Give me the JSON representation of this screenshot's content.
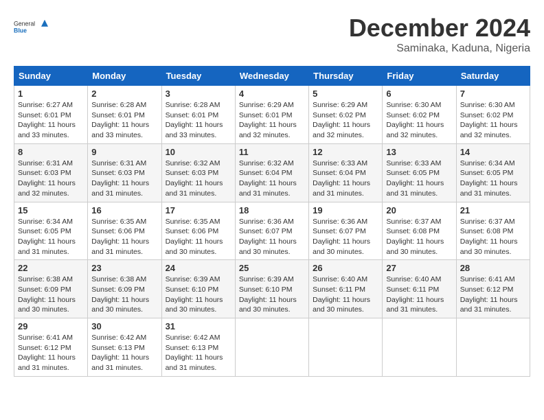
{
  "header": {
    "logo_general": "General",
    "logo_blue": "Blue",
    "month_year": "December 2024",
    "location": "Saminaka, Kaduna, Nigeria"
  },
  "weekdays": [
    "Sunday",
    "Monday",
    "Tuesday",
    "Wednesday",
    "Thursday",
    "Friday",
    "Saturday"
  ],
  "weeks": [
    [
      {
        "day": "1",
        "info": "Sunrise: 6:27 AM\nSunset: 6:01 PM\nDaylight: 11 hours\nand 33 minutes."
      },
      {
        "day": "2",
        "info": "Sunrise: 6:28 AM\nSunset: 6:01 PM\nDaylight: 11 hours\nand 33 minutes."
      },
      {
        "day": "3",
        "info": "Sunrise: 6:28 AM\nSunset: 6:01 PM\nDaylight: 11 hours\nand 33 minutes."
      },
      {
        "day": "4",
        "info": "Sunrise: 6:29 AM\nSunset: 6:01 PM\nDaylight: 11 hours\nand 32 minutes."
      },
      {
        "day": "5",
        "info": "Sunrise: 6:29 AM\nSunset: 6:02 PM\nDaylight: 11 hours\nand 32 minutes."
      },
      {
        "day": "6",
        "info": "Sunrise: 6:30 AM\nSunset: 6:02 PM\nDaylight: 11 hours\nand 32 minutes."
      },
      {
        "day": "7",
        "info": "Sunrise: 6:30 AM\nSunset: 6:02 PM\nDaylight: 11 hours\nand 32 minutes."
      }
    ],
    [
      {
        "day": "8",
        "info": "Sunrise: 6:31 AM\nSunset: 6:03 PM\nDaylight: 11 hours\nand 32 minutes."
      },
      {
        "day": "9",
        "info": "Sunrise: 6:31 AM\nSunset: 6:03 PM\nDaylight: 11 hours\nand 31 minutes."
      },
      {
        "day": "10",
        "info": "Sunrise: 6:32 AM\nSunset: 6:03 PM\nDaylight: 11 hours\nand 31 minutes."
      },
      {
        "day": "11",
        "info": "Sunrise: 6:32 AM\nSunset: 6:04 PM\nDaylight: 11 hours\nand 31 minutes."
      },
      {
        "day": "12",
        "info": "Sunrise: 6:33 AM\nSunset: 6:04 PM\nDaylight: 11 hours\nand 31 minutes."
      },
      {
        "day": "13",
        "info": "Sunrise: 6:33 AM\nSunset: 6:05 PM\nDaylight: 11 hours\nand 31 minutes."
      },
      {
        "day": "14",
        "info": "Sunrise: 6:34 AM\nSunset: 6:05 PM\nDaylight: 11 hours\nand 31 minutes."
      }
    ],
    [
      {
        "day": "15",
        "info": "Sunrise: 6:34 AM\nSunset: 6:05 PM\nDaylight: 11 hours\nand 31 minutes."
      },
      {
        "day": "16",
        "info": "Sunrise: 6:35 AM\nSunset: 6:06 PM\nDaylight: 11 hours\nand 31 minutes."
      },
      {
        "day": "17",
        "info": "Sunrise: 6:35 AM\nSunset: 6:06 PM\nDaylight: 11 hours\nand 30 minutes."
      },
      {
        "day": "18",
        "info": "Sunrise: 6:36 AM\nSunset: 6:07 PM\nDaylight: 11 hours\nand 30 minutes."
      },
      {
        "day": "19",
        "info": "Sunrise: 6:36 AM\nSunset: 6:07 PM\nDaylight: 11 hours\nand 30 minutes."
      },
      {
        "day": "20",
        "info": "Sunrise: 6:37 AM\nSunset: 6:08 PM\nDaylight: 11 hours\nand 30 minutes."
      },
      {
        "day": "21",
        "info": "Sunrise: 6:37 AM\nSunset: 6:08 PM\nDaylight: 11 hours\nand 30 minutes."
      }
    ],
    [
      {
        "day": "22",
        "info": "Sunrise: 6:38 AM\nSunset: 6:09 PM\nDaylight: 11 hours\nand 30 minutes."
      },
      {
        "day": "23",
        "info": "Sunrise: 6:38 AM\nSunset: 6:09 PM\nDaylight: 11 hours\nand 30 minutes."
      },
      {
        "day": "24",
        "info": "Sunrise: 6:39 AM\nSunset: 6:10 PM\nDaylight: 11 hours\nand 30 minutes."
      },
      {
        "day": "25",
        "info": "Sunrise: 6:39 AM\nSunset: 6:10 PM\nDaylight: 11 hours\nand 30 minutes."
      },
      {
        "day": "26",
        "info": "Sunrise: 6:40 AM\nSunset: 6:11 PM\nDaylight: 11 hours\nand 30 minutes."
      },
      {
        "day": "27",
        "info": "Sunrise: 6:40 AM\nSunset: 6:11 PM\nDaylight: 11 hours\nand 31 minutes."
      },
      {
        "day": "28",
        "info": "Sunrise: 6:41 AM\nSunset: 6:12 PM\nDaylight: 11 hours\nand 31 minutes."
      }
    ],
    [
      {
        "day": "29",
        "info": "Sunrise: 6:41 AM\nSunset: 6:12 PM\nDaylight: 11 hours\nand 31 minutes."
      },
      {
        "day": "30",
        "info": "Sunrise: 6:42 AM\nSunset: 6:13 PM\nDaylight: 11 hours\nand 31 minutes."
      },
      {
        "day": "31",
        "info": "Sunrise: 6:42 AM\nSunset: 6:13 PM\nDaylight: 11 hours\nand 31 minutes."
      },
      null,
      null,
      null,
      null
    ]
  ]
}
